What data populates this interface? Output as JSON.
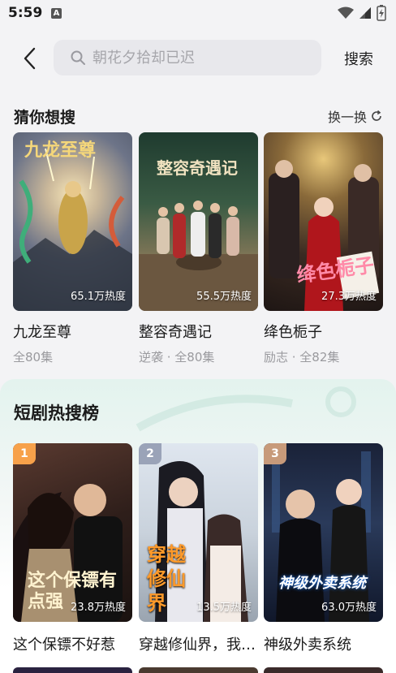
{
  "status": {
    "time": "5:59",
    "notification_letter": "A"
  },
  "header": {
    "search_placeholder": "朝花夕拾却已迟",
    "search_action": "搜索"
  },
  "guess": {
    "title": "猜你想搜",
    "refresh_label": "换一换",
    "items": [
      {
        "title": "九龙至尊",
        "subtitle": "全80集",
        "heat": "65.1万热度",
        "poster_text": "九龙至尊"
      },
      {
        "title": "整容奇遇记",
        "subtitle": "逆袭 · 全80集",
        "heat": "55.5万热度",
        "poster_text": "整容奇遇记"
      },
      {
        "title": "绛色栀子",
        "subtitle": "励志 · 全82集",
        "heat": "27.3万热度",
        "poster_text": "绛色栀子"
      }
    ]
  },
  "ranking": {
    "title": "短剧热搜榜",
    "items": [
      {
        "rank": "1",
        "title": "这个保镖不好惹",
        "heat": "23.8万热度",
        "poster_text": "这个保镖有点强",
        "badge_color": "#f7a14a"
      },
      {
        "rank": "2",
        "title": "穿越修仙界，我…",
        "heat": "13.5万热度",
        "poster_text": "穿越修仙界",
        "badge_color": "#9aa3b8"
      },
      {
        "rank": "3",
        "title": "神级外卖系统",
        "heat": "63.0万热度",
        "poster_text": "神级外卖系统",
        "badge_color": "#c79a7a"
      }
    ]
  }
}
